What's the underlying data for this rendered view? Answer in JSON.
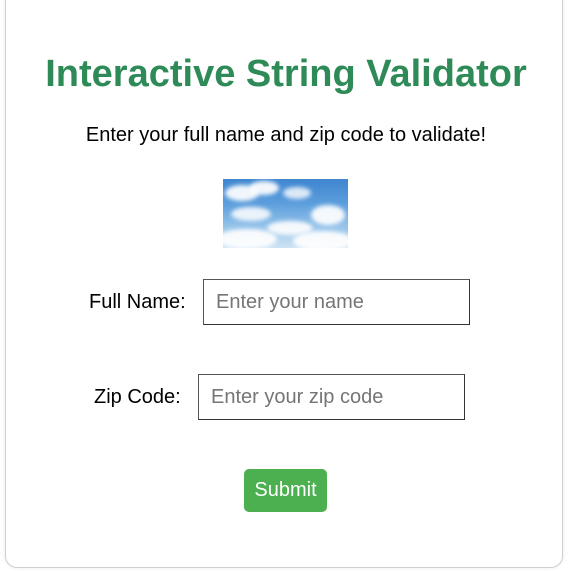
{
  "header": {
    "title": "Interactive String Validator",
    "subtitle": "Enter your full name and zip code to validate!"
  },
  "image": {
    "icon": "sky-clouds-image"
  },
  "form": {
    "name": {
      "label": "Full Name:",
      "value": "",
      "placeholder": "Enter your name"
    },
    "zip": {
      "label": "Zip Code:",
      "value": "",
      "placeholder": "Enter your zip code"
    },
    "submit_label": "Submit"
  },
  "colors": {
    "title": "#2e8b57",
    "submit_bg": "#4caf50",
    "submit_text": "#ffffff"
  }
}
